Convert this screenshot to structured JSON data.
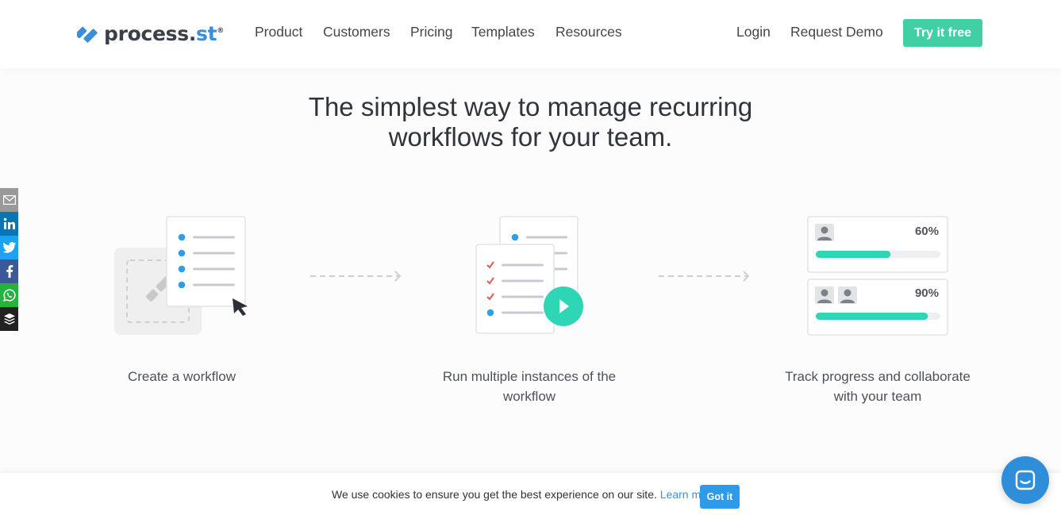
{
  "brand": {
    "name_main": "process.",
    "name_suffix": "st",
    "registered": "®",
    "accent": "#3a8fd8"
  },
  "nav": {
    "items": [
      "Product",
      "Customers",
      "Pricing",
      "Templates",
      "Resources"
    ],
    "login": "Login",
    "request_demo": "Request Demo",
    "cta": "Try it free",
    "cta_color": "#41d0a4"
  },
  "hero": {
    "line1": "The simplest way to manage recurring",
    "line2": "workflows for your team."
  },
  "share": {
    "icons": [
      "email-icon",
      "linkedin-icon",
      "twitter-icon",
      "facebook-icon",
      "whatsapp-icon",
      "buffer-icon"
    ],
    "colors": [
      "#9a9a9a",
      "#0a75b5",
      "#1da1f2",
      "#3b5998",
      "#25b33e",
      "#222222"
    ]
  },
  "steps": [
    {
      "caption_line1": "Create a workflow",
      "caption_line2": ""
    },
    {
      "caption_line1": "Run multiple instances of the",
      "caption_line2": "workflow"
    },
    {
      "caption_line1": "Track progress and collaborate",
      "caption_line2": "with your team"
    }
  ],
  "progress": [
    {
      "label": "60%",
      "value": 0.6,
      "users": 1
    },
    {
      "label": "90%",
      "value": 0.9,
      "users": 2
    }
  ],
  "cookie": {
    "text": "We use cookies to ensure you get the best experience on our site.",
    "link": "Learn more",
    "button": "Got it"
  }
}
